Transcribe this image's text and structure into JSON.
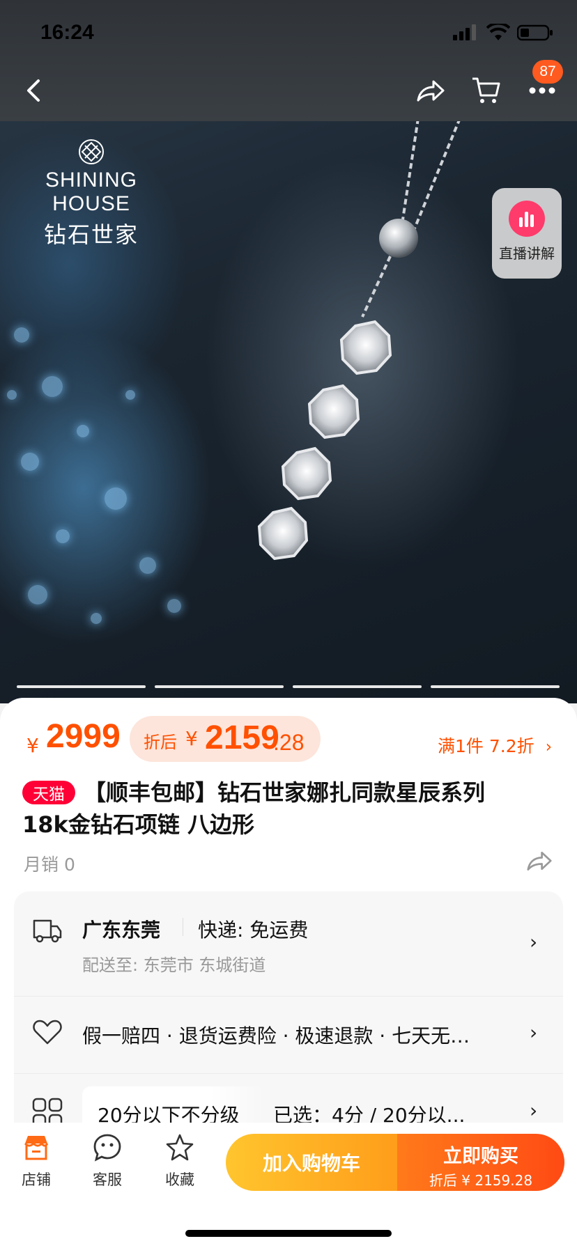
{
  "status": {
    "time": "16:24",
    "battery_level": 0.3
  },
  "nav": {
    "badge_count": "87"
  },
  "hero": {
    "brand_en": "SHINING HOUSE",
    "brand_cn": "钻石世家",
    "live_label": "直播讲解",
    "image_index": 4,
    "image_count": 4
  },
  "price": {
    "symbol": "¥",
    "original": "2999",
    "after_label": "折后",
    "after_symbol": "¥",
    "after_int": "2159",
    "after_dec": ".28",
    "promo": "满1件 7.2折"
  },
  "product": {
    "tmall_badge": "天猫",
    "title": "【顺丰包邮】钻石世家娜扎同款星辰系列18k金钻石项链 八边形",
    "sales": "月销 0"
  },
  "shipping": {
    "origin": "广东东莞",
    "method": "快递: 免运费",
    "dest": "配送至: 东莞市 东城街道"
  },
  "guarantee": {
    "text": "假一赔四 · 退货运费险 · 极速退款 · 七天无…"
  },
  "spec": {
    "note": "20分以下不分级",
    "selected": "已选：4分 / 20分以..."
  },
  "bottom": {
    "shop": "店铺",
    "service": "客服",
    "favorite": "收藏",
    "add_cart": "加入购物车",
    "buy_now": "立即购买",
    "buy_sub": "折后 ¥ 2159.28"
  },
  "colors": {
    "accent": "#ff5000",
    "tmall": "#ff0036",
    "cart_btn": "#ffb020",
    "buy_btn": "#ff5a14"
  }
}
